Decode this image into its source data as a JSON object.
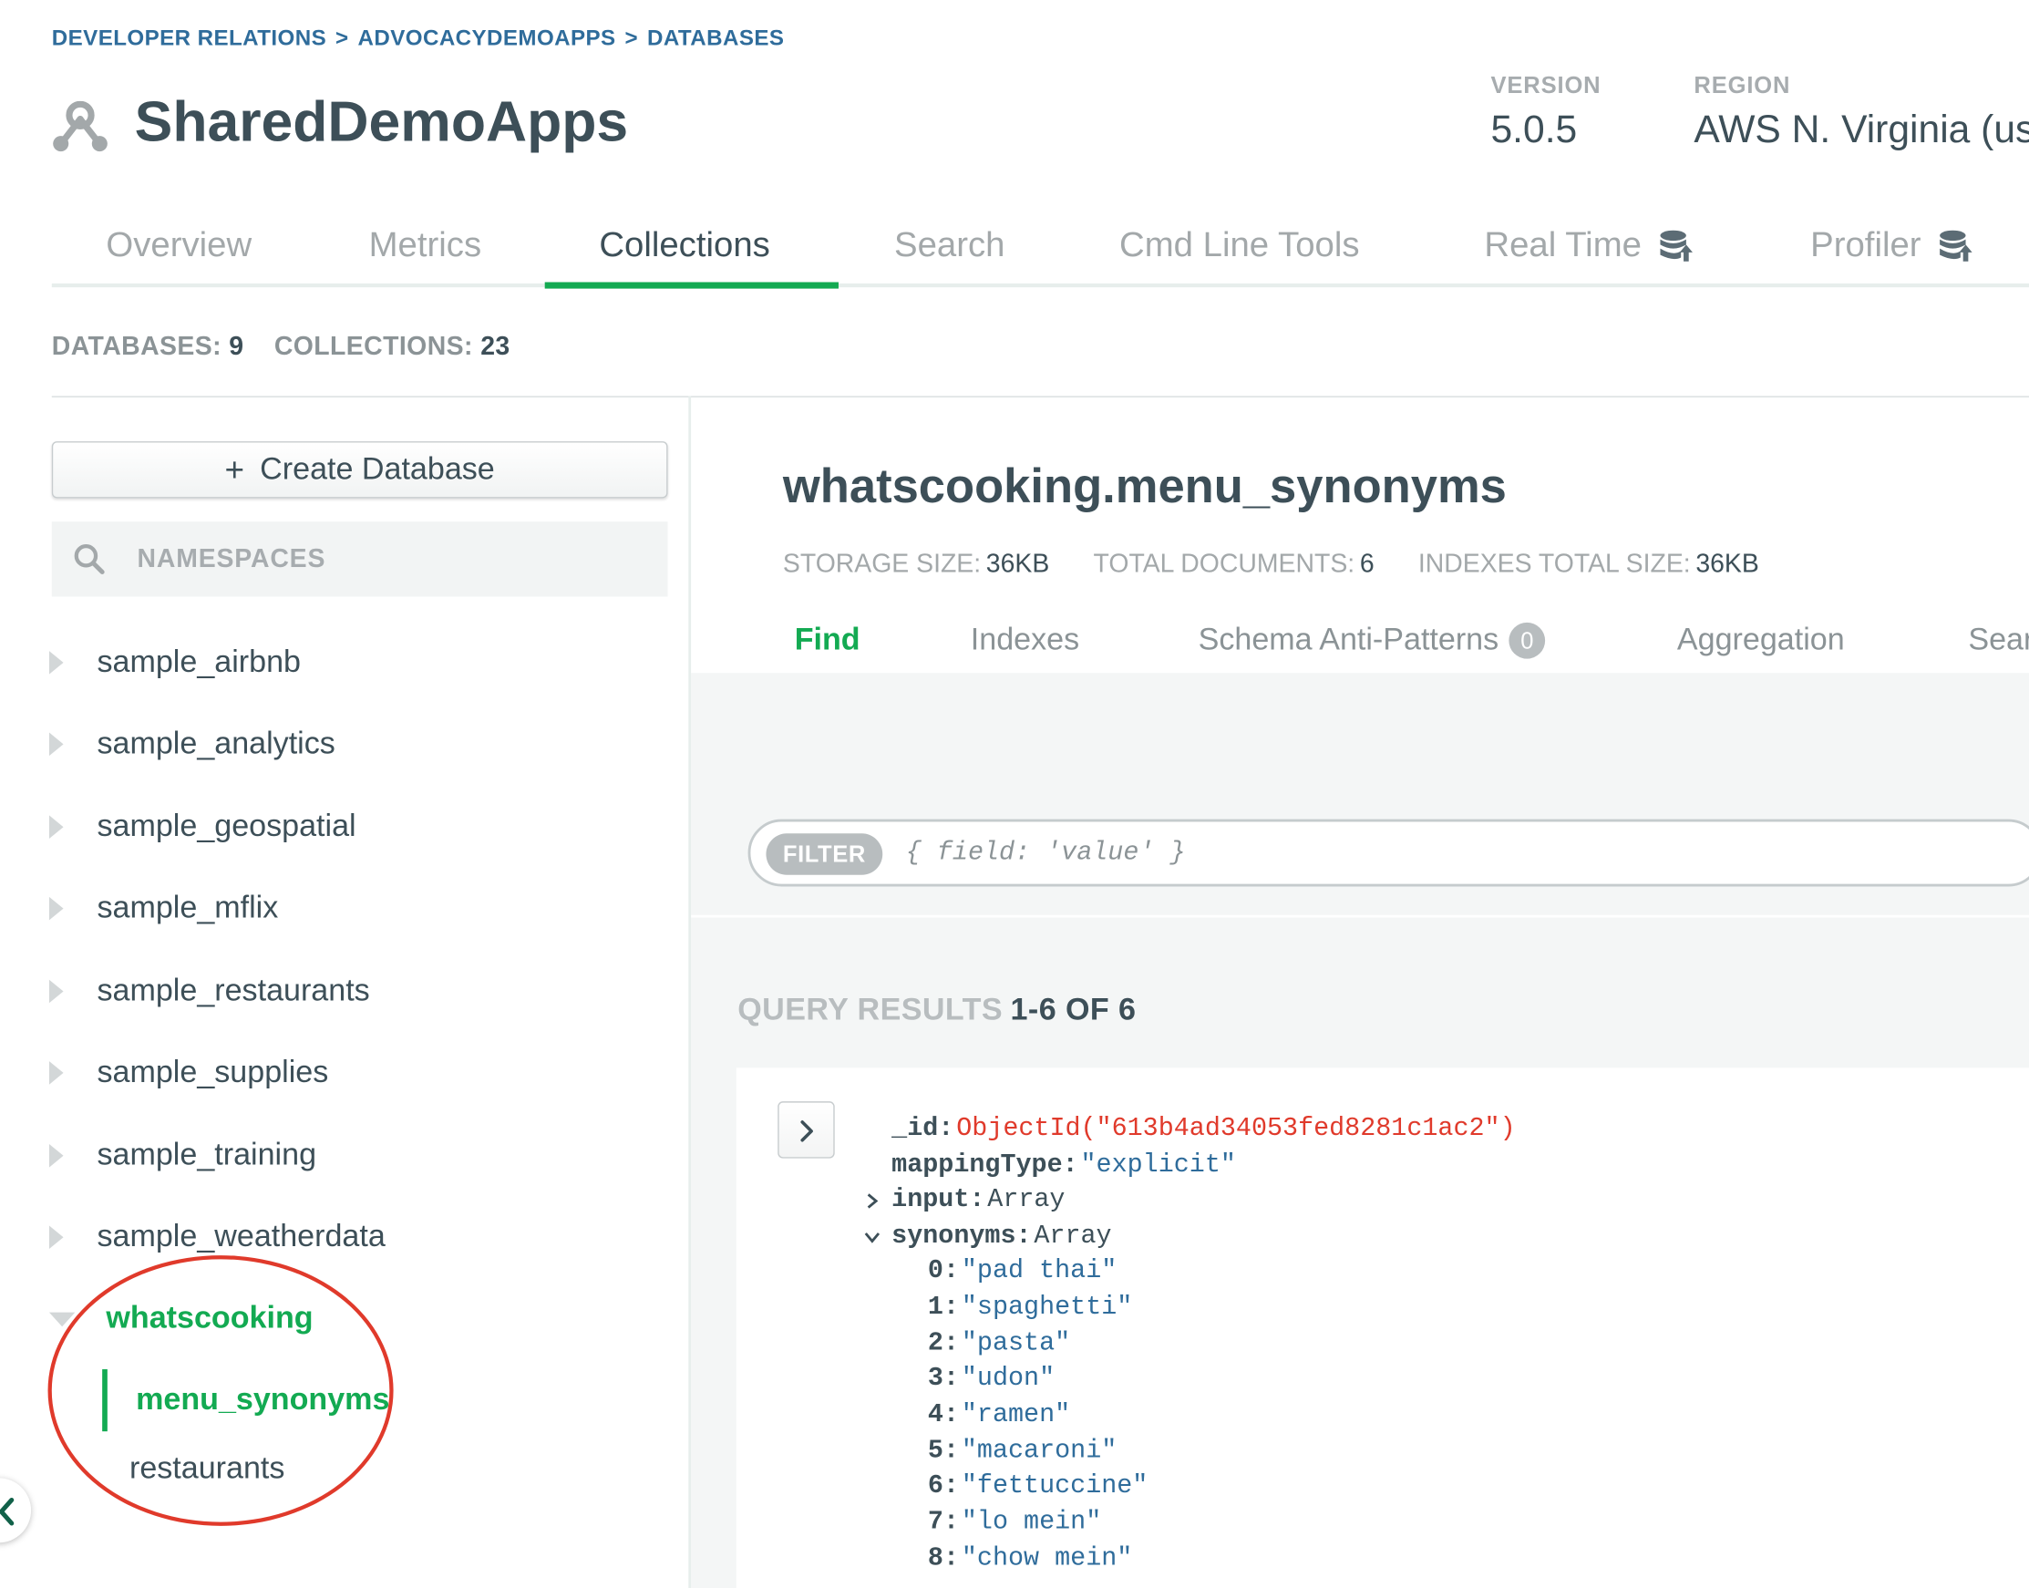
{
  "breadcrumb": [
    "DEVELOPER RELATIONS",
    "ADVOCACYDEMOAPPS",
    "DATABASES"
  ],
  "breadcrumb_separator": ">",
  "cluster": {
    "name": "SharedDemoApps",
    "icon": "cluster-icon",
    "version_label": "VERSION",
    "version": "5.0.5",
    "region_label": "REGION",
    "region": "AWS N. Virginia (us-"
  },
  "tabs": [
    {
      "label": "Overview"
    },
    {
      "label": "Metrics"
    },
    {
      "label": "Collections",
      "active": true
    },
    {
      "label": "Search"
    },
    {
      "label": "Cmd Line Tools"
    },
    {
      "label": "Real Time",
      "icon": "database-upgrade-icon"
    },
    {
      "label": "Profiler",
      "icon": "database-upgrade-icon"
    }
  ],
  "counts": {
    "databases_label": "DATABASES:",
    "databases": "9",
    "collections_label": "COLLECTIONS:",
    "collections": "23"
  },
  "sidebar": {
    "create_label": "Create Database",
    "create_icon": "+",
    "search_placeholder": "NAMESPACES",
    "databases": [
      "sample_airbnb",
      "sample_analytics",
      "sample_geospatial",
      "sample_mflix",
      "sample_restaurants",
      "sample_supplies",
      "sample_training",
      "sample_weatherdata"
    ],
    "expanded_db": "whatscooking",
    "collections": [
      {
        "name": "menu_synonyms",
        "active": true
      },
      {
        "name": "restaurants"
      }
    ]
  },
  "collection": {
    "title": "whatscooking.menu_synonyms",
    "storage_label": "STORAGE SIZE:",
    "storage": "36KB",
    "docs_label": "TOTAL DOCUMENTS:",
    "docs": "6",
    "indexes_label": "INDEXES TOTAL SIZE:",
    "indexes": "36KB",
    "subtabs": [
      {
        "label": "Find",
        "active": true
      },
      {
        "label": "Indexes"
      },
      {
        "label": "Schema Anti-Patterns",
        "badge": "0"
      },
      {
        "label": "Aggregation"
      },
      {
        "label": "Sear"
      }
    ],
    "filter_label": "FILTER",
    "filter_placeholder": "{ field: 'value' }",
    "results_label": "QUERY RESULTS",
    "results_range": "1-6 OF 6"
  },
  "document": {
    "id_key": "_id",
    "id_value": "ObjectId(\"613b4ad34053fed8281c1ac2\")",
    "mapping_key": "mappingType",
    "mapping_value": "\"explicit\"",
    "input_key": "input",
    "input_type": "Array",
    "synonyms_key": "synonyms",
    "synonyms_type": "Array",
    "synonyms": [
      {
        "index": "0",
        "value": "\"pad thai\""
      },
      {
        "index": "1",
        "value": "\"spaghetti\""
      },
      {
        "index": "2",
        "value": "\"pasta\""
      },
      {
        "index": "3",
        "value": "\"udon\""
      },
      {
        "index": "4",
        "value": "\"ramen\""
      },
      {
        "index": "5",
        "value": "\"macaroni\""
      },
      {
        "index": "6",
        "value": "\"fettuccine\""
      },
      {
        "index": "7",
        "value": "\"lo mein\""
      },
      {
        "index": "8",
        "value": "\"chow mein\""
      }
    ]
  },
  "colors": {
    "accent_green": "#13aa52",
    "link_blue": "#2f6c9b",
    "objectid_red": "#e03a2b",
    "annotation_red": "#e03a2b"
  }
}
